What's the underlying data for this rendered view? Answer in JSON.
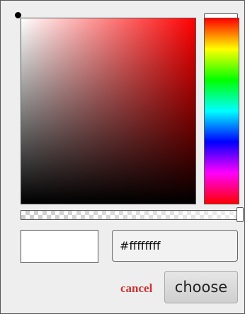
{
  "color_picker": {
    "hue_color": "#ff0000",
    "selected_color": "#ffffff",
    "hex_value": "#ffffffff",
    "alpha": 1.0,
    "hue": 0,
    "saturation": 0,
    "brightness": 1.0,
    "cancel_label": "cancel",
    "choose_label": "choose",
    "cancel_color": "#cc3333"
  }
}
